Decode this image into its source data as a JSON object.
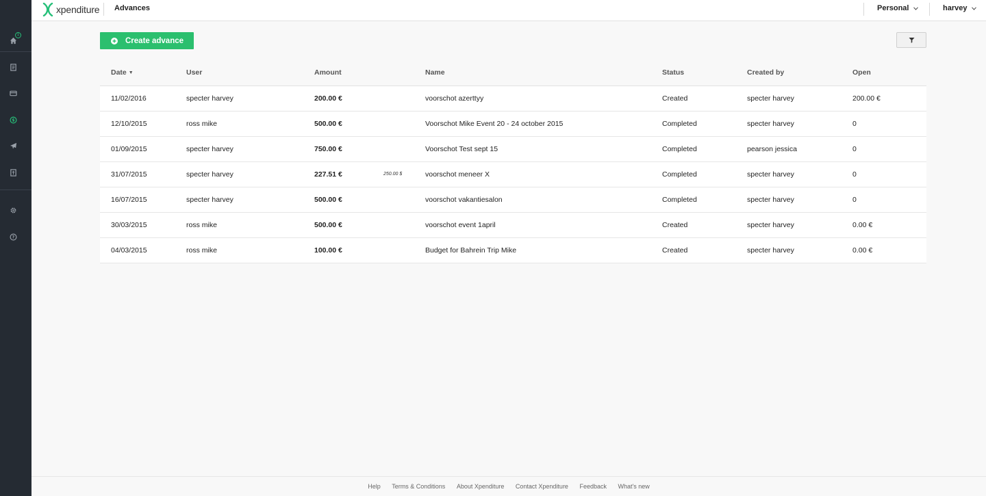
{
  "app": {
    "logo_text": "xpenditure",
    "page_title": "Advances"
  },
  "header": {
    "workspace": "Personal",
    "user": "harvey"
  },
  "sidebar": {
    "badge": "1",
    "items": [
      {
        "name": "home-icon"
      },
      {
        "name": "receipt-icon"
      },
      {
        "name": "card-icon"
      },
      {
        "name": "advance-icon"
      },
      {
        "name": "plane-icon"
      },
      {
        "name": "report-icon"
      },
      {
        "name": "gear-icon"
      },
      {
        "name": "help-icon"
      }
    ]
  },
  "toolbar": {
    "create_label": "Create advance"
  },
  "table": {
    "headers": {
      "date": "Date",
      "user": "User",
      "amount": "Amount",
      "name": "Name",
      "status": "Status",
      "created_by": "Created by",
      "open": "Open"
    },
    "sort_indicator": "▼",
    "rows": [
      {
        "date": "11/02/2016",
        "user": "specter harvey",
        "amount": "200.00 €",
        "original": "",
        "name": "voorschot azerttyy",
        "status": "Created",
        "created_by": "specter harvey",
        "open": "200.00 €"
      },
      {
        "date": "12/10/2015",
        "user": "ross mike",
        "amount": "500.00 €",
        "original": "",
        "name": "Voorschot Mike Event 20 - 24 october 2015",
        "status": "Completed",
        "created_by": "specter harvey",
        "open": "0"
      },
      {
        "date": "01/09/2015",
        "user": "specter harvey",
        "amount": "750.00 €",
        "original": "",
        "name": "Voorschot Test sept 15",
        "status": "Completed",
        "created_by": "pearson jessica",
        "open": "0"
      },
      {
        "date": "31/07/2015",
        "user": "specter harvey",
        "amount": "227.51 €",
        "original": "250.00 $",
        "name": "voorschot meneer X",
        "status": "Completed",
        "created_by": "specter harvey",
        "open": "0"
      },
      {
        "date": "16/07/2015",
        "user": "specter harvey",
        "amount": "500.00 €",
        "original": "",
        "name": "voorschot vakantiesalon",
        "status": "Completed",
        "created_by": "specter harvey",
        "open": "0"
      },
      {
        "date": "30/03/2015",
        "user": "ross mike",
        "amount": "500.00 €",
        "original": "",
        "name": "voorschot event 1april",
        "status": "Created",
        "created_by": "specter harvey",
        "open": "0.00 €"
      },
      {
        "date": "04/03/2015",
        "user": "ross mike",
        "amount": "100.00 €",
        "original": "",
        "name": "Budget for Bahrein Trip Mike",
        "status": "Created",
        "created_by": "specter harvey",
        "open": "0.00 €"
      }
    ]
  },
  "footer": {
    "links": [
      "Help",
      "Terms & Conditions",
      "About Xpenditure",
      "Contact Xpenditure",
      "Feedback",
      "What's new"
    ]
  },
  "colors": {
    "sidebar_bg": "#252b33",
    "accent_green": "#2bbf6e",
    "icon_gray": "#9aa1aa"
  }
}
